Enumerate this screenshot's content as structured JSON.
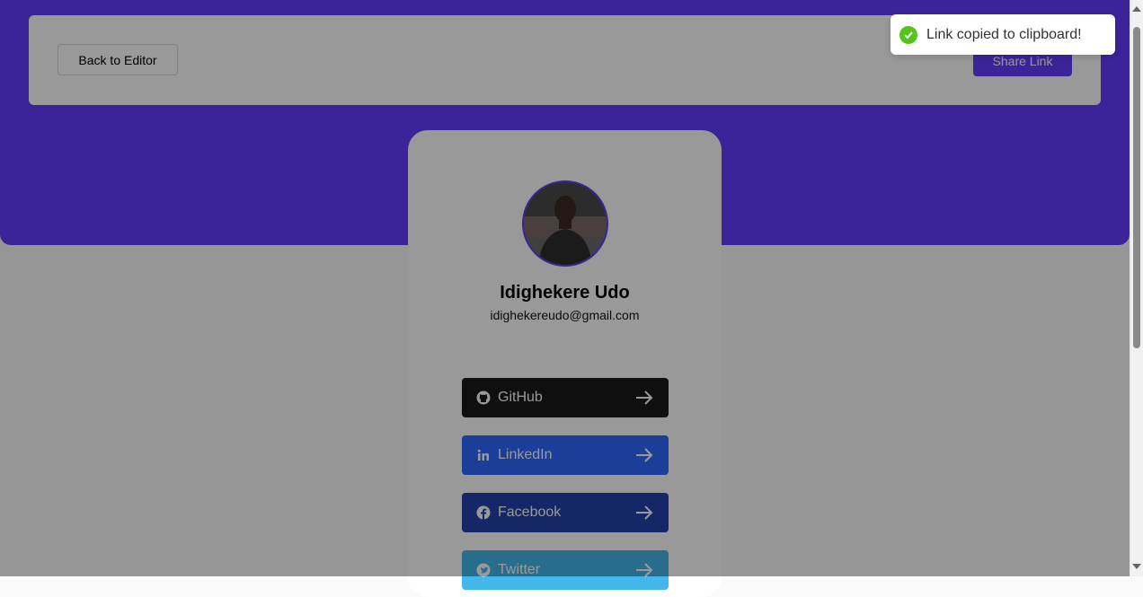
{
  "nav": {
    "back_label": "Back to Editor",
    "share_label": "Share Link"
  },
  "profile": {
    "name": "Idighekere Udo",
    "email": "idighekereudo@gmail.com"
  },
  "links": [
    {
      "label": "GitHub",
      "icon": "github-icon",
      "color": "#1a1a1a"
    },
    {
      "label": "LinkedIn",
      "icon": "linkedin-icon",
      "color": "#2d68ff"
    },
    {
      "label": "Facebook",
      "icon": "facebook-icon",
      "color": "#2442ac"
    },
    {
      "label": "Twitter",
      "icon": "twitter-icon",
      "color": "#43b7e9"
    }
  ],
  "toast": {
    "message": "Link copied to clipboard!",
    "icon": "check-circle-icon"
  },
  "colors": {
    "accent": "#633cff",
    "success": "#52c41a"
  }
}
